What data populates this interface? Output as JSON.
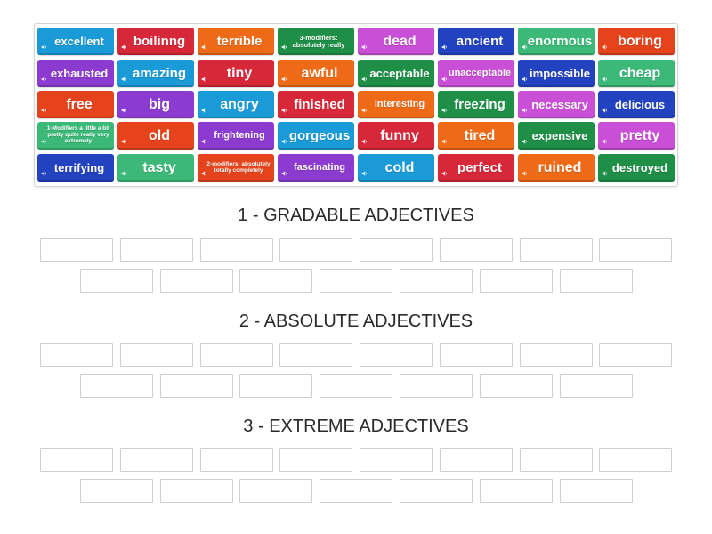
{
  "tiles": [
    {
      "label": "excellent",
      "color": "#1a9bd8"
    },
    {
      "label": "boilinng",
      "color": "#d7283a"
    },
    {
      "label": "terrible",
      "color": "#ee6a16"
    },
    {
      "label": "3-modifiers: absolutely really",
      "color": "#1f8f47"
    },
    {
      "label": "dead",
      "color": "#c94fd6"
    },
    {
      "label": "ancient",
      "color": "#2342bf"
    },
    {
      "label": "enormous",
      "color": "#3cb878"
    },
    {
      "label": "boring",
      "color": "#e5431b"
    },
    {
      "label": "exhausted",
      "color": "#8b3bd0"
    },
    {
      "label": "amazing",
      "color": "#1a9bd8"
    },
    {
      "label": "tiny",
      "color": "#d7283a"
    },
    {
      "label": "awful",
      "color": "#ee6a16"
    },
    {
      "label": "acceptable",
      "color": "#1f8f47"
    },
    {
      "label": "unacceptable",
      "color": "#c94fd6"
    },
    {
      "label": "impossible",
      "color": "#2342bf"
    },
    {
      "label": "cheap",
      "color": "#3cb878"
    },
    {
      "label": "free",
      "color": "#e5431b"
    },
    {
      "label": "big",
      "color": "#8b3bd0"
    },
    {
      "label": "angry",
      "color": "#1a9bd8"
    },
    {
      "label": "finished",
      "color": "#d7283a"
    },
    {
      "label": "interesting",
      "color": "#ee6a16"
    },
    {
      "label": "freezing",
      "color": "#1f8f47"
    },
    {
      "label": "necessary",
      "color": "#c94fd6"
    },
    {
      "label": "delicious",
      "color": "#2342bf"
    },
    {
      "label": "1-Modifiers a little a bit pretty quite really very extremely",
      "color": "#3cb878"
    },
    {
      "label": "old",
      "color": "#e5431b"
    },
    {
      "label": "frightening",
      "color": "#8b3bd0"
    },
    {
      "label": "gorgeous",
      "color": "#1a9bd8"
    },
    {
      "label": "funny",
      "color": "#d7283a"
    },
    {
      "label": "tired",
      "color": "#ee6a16"
    },
    {
      "label": "expensive",
      "color": "#1f8f47"
    },
    {
      "label": "pretty",
      "color": "#c94fd6"
    },
    {
      "label": "terrifying",
      "color": "#2342bf"
    },
    {
      "label": "tasty",
      "color": "#3cb878"
    },
    {
      "label": "2-modifiers: absolutely totally completely",
      "color": "#e5431b"
    },
    {
      "label": "fascinating",
      "color": "#8b3bd0"
    },
    {
      "label": "cold",
      "color": "#1a9bd8"
    },
    {
      "label": "perfect",
      "color": "#d7283a"
    },
    {
      "label": "ruined",
      "color": "#ee6a16"
    },
    {
      "label": "destroyed",
      "color": "#1f8f47"
    }
  ],
  "icons": {
    "tile_icon": "speaker-icon"
  },
  "sections": [
    {
      "title": "1 - GRADABLE ADJECTIVES",
      "slot_count": 15
    },
    {
      "title": "2 - ABSOLUTE ADJECTIVES",
      "slot_count": 15
    },
    {
      "title": "3 - EXTREME ADJECTIVES",
      "slot_count": 15
    }
  ]
}
